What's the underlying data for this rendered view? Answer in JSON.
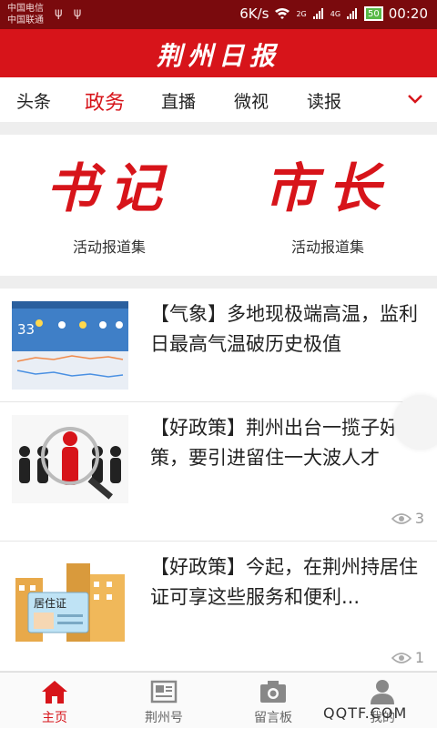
{
  "statusbar": {
    "carrier1": "中国电信",
    "carrier2": "中国联通",
    "usb": "ψ ψ",
    "speed": "6K/s",
    "net1": "2G",
    "net2": "4G",
    "battery": "50",
    "time": "00:20"
  },
  "header": {
    "logo": "荆州日报"
  },
  "tabs": [
    {
      "label": "头条"
    },
    {
      "label": "政务"
    },
    {
      "label": "直播"
    },
    {
      "label": "微视"
    },
    {
      "label": "读报"
    }
  ],
  "features": [
    {
      "calligraphy": "书记",
      "caption": "活动报道集"
    },
    {
      "calligraphy": "市长",
      "caption": "活动报道集"
    }
  ],
  "news": [
    {
      "title": "【气象】多地现极端高温，监利日最高气温破历史极值",
      "views": ""
    },
    {
      "title": "【好政策】荆州出台一揽子好政策，要引进留住一大波人才",
      "views": "3"
    },
    {
      "title": "【好政策】今起，在荆州持居住证可享这些服务和便利...",
      "views": "1"
    }
  ],
  "thumbs": {
    "weather_temp": "33",
    "residence_card": "居住证"
  },
  "bottomnav": [
    {
      "label": "主页",
      "icon": "home-icon"
    },
    {
      "label": "荆州号",
      "icon": "newspaper-icon"
    },
    {
      "label": "留言板",
      "icon": "camera-icon"
    },
    {
      "label": "我的",
      "icon": "user-icon"
    }
  ],
  "watermark": "QQTF.COM",
  "colors": {
    "brand": "#d7141a",
    "statusbar": "#7a0a0d"
  }
}
